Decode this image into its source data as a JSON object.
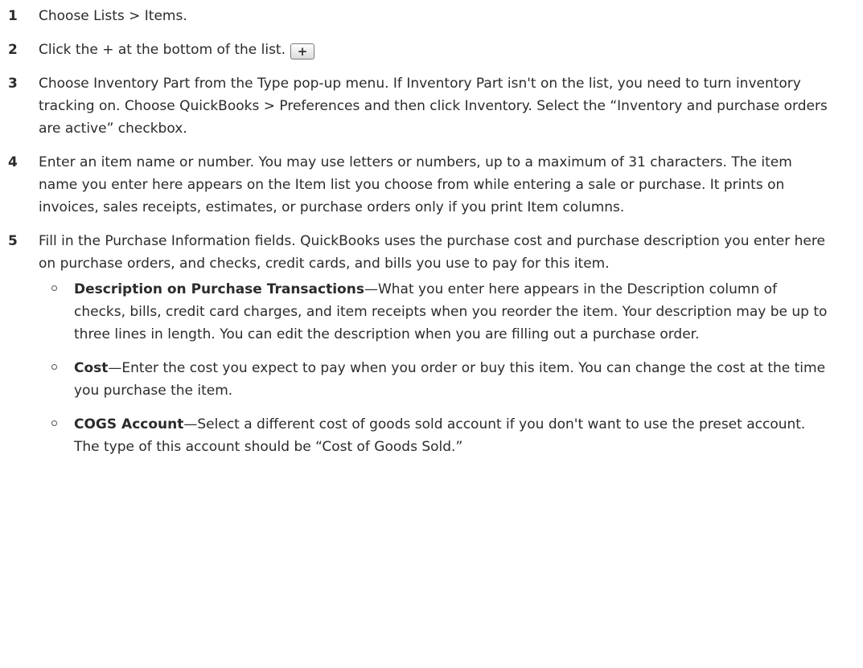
{
  "steps": [
    {
      "number": "1",
      "text": "Choose Lists > Items."
    },
    {
      "number": "2",
      "text": "Click the + at the bottom of the list.",
      "button_label": "+"
    },
    {
      "number": "3",
      "text": "Choose Inventory Part from the Type pop-up menu. If Inventory Part isn't on the list, you need to turn inventory tracking on. Choose QuickBooks > Preferences and then click Inventory. Select the “Inventory and purchase orders are active” checkbox."
    },
    {
      "number": "4",
      "text": "Enter an item name or number. You may use letters or numbers, up to a maximum of 31 characters. The item name you enter here appears on the Item list you choose from while entering a sale or purchase. It prints on invoices, sales receipts, estimates, or purchase orders only if you print Item columns."
    },
    {
      "number": "5",
      "text": "Fill in the Purchase Information fields. QuickBooks uses the purchase cost and purchase description you enter here on purchase orders, and checks, credit cards, and bills you use to pay for this item.",
      "subitems": [
        {
          "term": "Description on Purchase Transactions",
          "text": "—What you enter here appears in the Description column of checks, bills, credit card charges, and item receipts when you reorder the item. Your description may be up to three lines in length. You can edit the description when you are filling out a purchase order."
        },
        {
          "term": "Cost",
          "text": "—Enter the cost you expect to pay when you order or buy this item. You can change the cost at the time you purchase the item."
        },
        {
          "term": "COGS Account",
          "text": "—Select a different cost of goods sold account if you don't want to use the preset account. The type of this account should be “Cost of Goods Sold.”"
        }
      ]
    }
  ]
}
